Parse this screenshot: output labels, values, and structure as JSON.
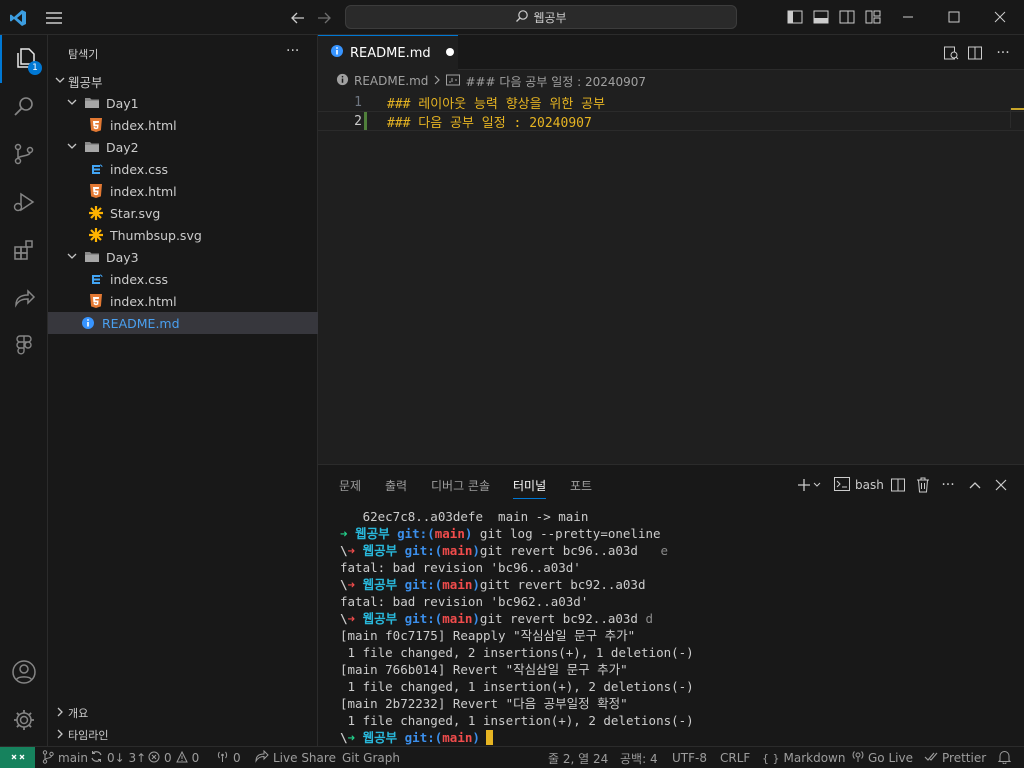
{
  "titlebar": {
    "search_text": "웹공부"
  },
  "activity": {
    "explorer_badge": "1"
  },
  "sidebar": {
    "title": "탐색기",
    "root": "웹공부",
    "tree": [
      {
        "label": "Day1",
        "kind": "folder",
        "depth": 1
      },
      {
        "label": "index.html",
        "kind": "html",
        "depth": 2
      },
      {
        "label": "Day2",
        "kind": "folder",
        "depth": 1
      },
      {
        "label": "index.css",
        "kind": "css",
        "depth": 2
      },
      {
        "label": "index.html",
        "kind": "html",
        "depth": 2
      },
      {
        "label": "Star.svg",
        "kind": "svg",
        "depth": 2
      },
      {
        "label": "Thumbsup.svg",
        "kind": "svg",
        "depth": 2
      },
      {
        "label": "Day3",
        "kind": "folder",
        "depth": 1
      },
      {
        "label": "index.css",
        "kind": "css",
        "depth": 2
      },
      {
        "label": "index.html",
        "kind": "html",
        "depth": 2
      },
      {
        "label": "README.md",
        "kind": "info",
        "depth": 1
      }
    ],
    "outline_label": "개요",
    "timeline_label": "타임라인"
  },
  "editor": {
    "tab_label": "README.md",
    "breadcrumb": {
      "file": "README.md",
      "symbol": "### 다음 공부 일정 : 20240907"
    },
    "lines": [
      {
        "num": "1",
        "text": "### 레이아웃 능력 향상을 위한 공부"
      },
      {
        "num": "2",
        "text": "### 다음 공부 일정 : 20240907"
      }
    ]
  },
  "panel": {
    "tabs": [
      "문제",
      "출력",
      "디버그 콘솔",
      "터미널",
      "포트"
    ],
    "active_tab": "터미널",
    "shell_label": "bash",
    "terminal": {
      "prompt_dir": "웹공부",
      "git_label": "git:(",
      "branch": "main",
      "git_close": ")",
      "arrow": "➜",
      "backslash": "\\",
      "lines": {
        "l1": "   62ec7c8..a03defe  main -> main",
        "l2_cmd": " git log --pretty=oneline",
        "l3_cmd": "git revert bc96..a03d",
        "l3_tail": "   e",
        "l4": "fatal: bad revision 'bc96..a03d'",
        "l5_cmd": "gitt revert bc92..a03d",
        "l6": "fatal: bad revision 'bc962..a03d'",
        "l7_cmd": "git revert bc92..a03d",
        "l7_tail": " d",
        "l8": "[main f0c7175] Reapply \"작심삼일 문구 추가\"",
        "l9": " 1 file changed, 2 insertions(+), 1 deletion(-)",
        "l10": "[main 766b014] Revert \"작심삼일 문구 추가\"",
        "l11": " 1 file changed, 1 insertion(+), 2 deletions(-)",
        "l12": "[main 2b72232] Revert \"다음 공부일정 확정\"",
        "l13": " 1 file changed, 1 insertion(+), 2 deletions(-)"
      }
    }
  },
  "statusbar": {
    "branch": "main",
    "sync": "0↓ 3↑",
    "errors": "0",
    "warnings": "0",
    "ports": "0",
    "live_share": "Live Share",
    "git_graph": "Git Graph",
    "position": "줄 2, 열 24",
    "spaces": "공백: 4",
    "encoding": "UTF-8",
    "eol": "CRLF",
    "language": "Markdown",
    "go_live": "Go Live",
    "prettier": "Prettier"
  },
  "colors": {
    "accent": "#0078d4",
    "remote_bg": "#16825d",
    "heading": "#e6b422",
    "html_icon": "#e37933",
    "css_icon": "#42a5f5",
    "svg_icon": "#ffb300",
    "info_icon": "#3794ff"
  }
}
